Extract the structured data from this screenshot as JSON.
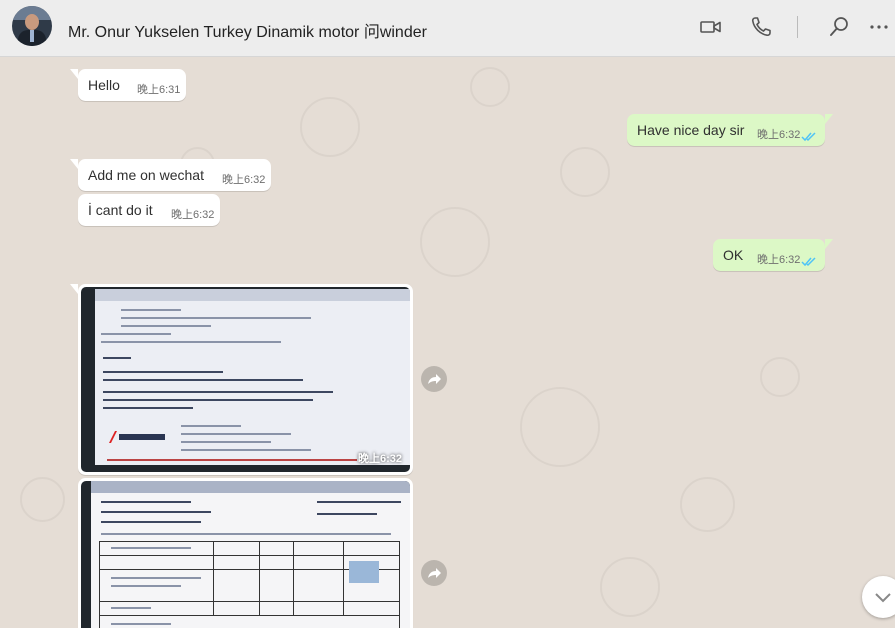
{
  "header": {
    "title": "Mr. Onur Yukselen Turkey Dinamik motor 问winder"
  },
  "messages": {
    "m1": {
      "text": "Hello",
      "time": "晚上6:31"
    },
    "m2": {
      "text": "Have nice day sir",
      "time": "晚上6:32"
    },
    "m3": {
      "text": "Add me on wechat",
      "time": "晚上6:32"
    },
    "m4": {
      "text": "İ cant do it",
      "time": "晚上6:32"
    },
    "m5": {
      "text": "OK",
      "time": "晚上6:32"
    },
    "img1": {
      "time": "晚上6:32"
    }
  },
  "colors": {
    "chat_background": "#e5ddd5",
    "incoming_bubble": "#ffffff",
    "outgoing_bubble": "#dcf8c6",
    "read_ticks": "#4fc3f7"
  },
  "icons": [
    "video-call-icon",
    "voice-call-icon",
    "search-icon",
    "more-options-icon",
    "forward-icon",
    "read-receipt-icon",
    "scroll-down-icon"
  ]
}
